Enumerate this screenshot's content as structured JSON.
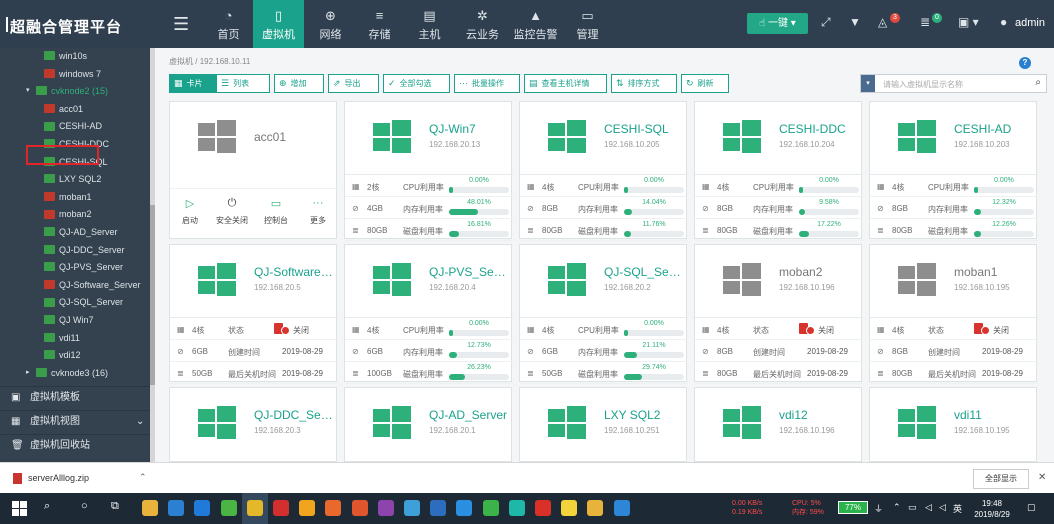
{
  "app": {
    "title": "超融合管理平台"
  },
  "nav": [
    {
      "label": "首页",
      "icon": "dashboard-icon",
      "glyph": "◔"
    },
    {
      "label": "虚拟机",
      "icon": "phone-icon",
      "glyph": "▯"
    },
    {
      "label": "网络",
      "icon": "globe-icon",
      "glyph": "⊕"
    },
    {
      "label": "存储",
      "icon": "database-icon",
      "glyph": "≡"
    },
    {
      "label": "主机",
      "icon": "server-icon",
      "glyph": "▤"
    },
    {
      "label": "云业务",
      "icon": "gear-icon",
      "glyph": "✲"
    },
    {
      "label": "监控告警",
      "icon": "bell-icon",
      "glyph": "▲"
    },
    {
      "label": "管理",
      "icon": "monitor-icon",
      "glyph": "▭"
    }
  ],
  "top": {
    "one_click": "一键",
    "bell_count": "3",
    "msg_count": "0",
    "user": "admin"
  },
  "tree": {
    "items": [
      {
        "label": "win10s",
        "status": "g"
      },
      {
        "label": "windows 7",
        "status": "r"
      },
      {
        "label": "cvknode2 (15)",
        "status": "g"
      },
      {
        "label": "acc01",
        "status": "r"
      },
      {
        "label": "CESHI-AD",
        "status": "g"
      },
      {
        "label": "CESHI-DDC",
        "status": "g"
      },
      {
        "label": "CESHI-SQL",
        "status": "g"
      },
      {
        "label": "LXY SQL2",
        "status": "g"
      },
      {
        "label": "moban1",
        "status": "r"
      },
      {
        "label": "moban2",
        "status": "r"
      },
      {
        "label": "QJ-AD_Server",
        "status": "g"
      },
      {
        "label": "QJ-DDC_Server",
        "status": "g"
      },
      {
        "label": "QJ-PVS_Server",
        "status": "g"
      },
      {
        "label": "QJ-Software_Server",
        "status": "r"
      },
      {
        "label": "QJ-SQL_Server",
        "status": "g"
      },
      {
        "label": "QJ Win7",
        "status": "g"
      },
      {
        "label": "vdi11",
        "status": "g"
      },
      {
        "label": "vdi12",
        "status": "g"
      },
      {
        "label": "cvknode3 (16)",
        "status": "g"
      }
    ],
    "sections": [
      "虚拟机模板",
      "虚拟机视图",
      "虚拟机回收站"
    ]
  },
  "breadcrumb": {
    "root": "虚拟机",
    "sep": "/",
    "current": "192.168.10.11"
  },
  "toolbar": {
    "card": "卡片",
    "list": "列表",
    "add": "增加",
    "export": "导出",
    "select_all": "全部勾选",
    "batch": "批量操作",
    "host_detail": "查看主机详情",
    "sort": "排序方式",
    "refresh": "刷新"
  },
  "filter": {
    "type": "▾",
    "placeholder": "请输入虚拟机显示名称"
  },
  "labels": {
    "cpu": "CPU利用率",
    "mem": "内存利用率",
    "disk": "磁盘利用率",
    "state": "状态",
    "created": "创建时间",
    "last_off": "最后关机时间",
    "off": "关闭"
  },
  "acc01": {
    "name": "acc01",
    "actions": [
      "启动",
      "安全关闭",
      "控制台",
      "更多"
    ]
  },
  "cards": [
    {
      "name": "QJ-Win7",
      "ip": "192.168.20.13",
      "running": true,
      "cores": "2核",
      "mem": "4GB",
      "disk": "80GB",
      "cpu": 0.0,
      "memu": 48.01,
      "disku": 16.81
    },
    {
      "name": "CESHI-SQL",
      "ip": "192.168.10.205",
      "running": true,
      "cores": "4核",
      "mem": "8GB",
      "disk": "80GB",
      "cpu": 0.0,
      "memu": 14.04,
      "disku": 11.76
    },
    {
      "name": "CESHI-DDC",
      "ip": "192.168.10.204",
      "running": true,
      "cores": "4核",
      "mem": "8GB",
      "disk": "80GB",
      "cpu": 0.0,
      "memu": 9.58,
      "disku": 17.22
    },
    {
      "name": "CESHI-AD",
      "ip": "192.168.10.203",
      "running": true,
      "cores": "4核",
      "mem": "8GB",
      "disk": "80GB",
      "cpu": 0.0,
      "memu": 12.32,
      "disku": 12.26
    },
    {
      "name": "QJ-Software_Server",
      "ip": "192.168.20.5",
      "running": false,
      "cores": "4核",
      "mem": "6GB",
      "disk": "50GB",
      "created": "2019-08-29",
      "last": "2019-08-29"
    },
    {
      "name": "QJ-PVS_Server",
      "ip": "192.168.20.4",
      "running": true,
      "cores": "4核",
      "mem": "6GB",
      "disk": "100GB",
      "cpu": 0.0,
      "memu": 12.73,
      "disku": 26.23
    },
    {
      "name": "QJ-SQL_Server",
      "ip": "192.168.20.2",
      "running": true,
      "cores": "4核",
      "mem": "6GB",
      "disk": "50GB",
      "cpu": 0.0,
      "memu": 21.11,
      "disku": 29.74
    },
    {
      "name": "moban2",
      "ip": "192.168.10.196",
      "running": false,
      "gray": true,
      "cores": "4核",
      "mem": "8GB",
      "disk": "80GB",
      "created": "2019-08-29",
      "last": "2019-08-29"
    },
    {
      "name": "moban1",
      "ip": "192.168.10.195",
      "running": false,
      "gray": true,
      "cores": "4核",
      "mem": "8GB",
      "disk": "80GB",
      "created": "2019-08-29",
      "last": "2019-08-29"
    },
    {
      "name": "QJ-DDC_Server",
      "ip": "192.168.20.3",
      "running": true
    },
    {
      "name": "QJ-AD_Server",
      "ip": "192.168.20.1",
      "running": true
    },
    {
      "name": "LXY SQL2",
      "ip": "192.168.10.251",
      "running": true
    },
    {
      "name": "vdi12",
      "ip": "192.168.10.196",
      "running": true
    },
    {
      "name": "vdi11",
      "ip": "192.168.10.195",
      "running": true
    }
  ],
  "download": {
    "file": "serverAlllog.zip",
    "show_all": "全部显示"
  },
  "taskbar": {
    "net_up": "0.00 KB/s",
    "net_down": "0.19 KB/s",
    "cpu": "CPU: 5%",
    "mem": "内存: 59%",
    "battery": "77%",
    "ime": "英",
    "time": "19:48",
    "date": "2019/8/29"
  },
  "colors": {
    "accent": "#1aa28c",
    "vm_green": "#2eb07a",
    "stopped": "#d6342d",
    "sidebar": "#34424f"
  }
}
